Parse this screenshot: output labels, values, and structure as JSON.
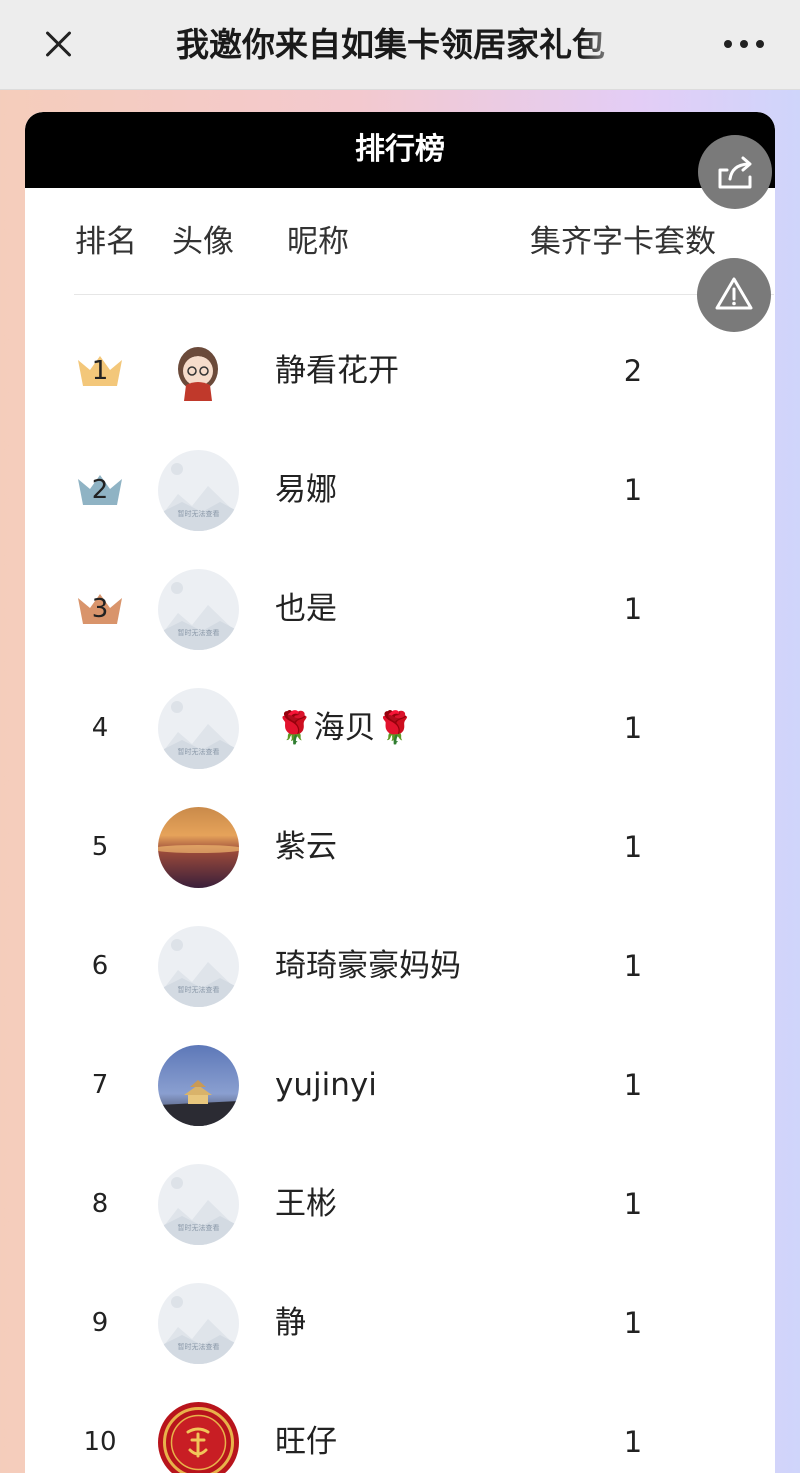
{
  "topbar": {
    "title": "我邀你来自如集卡领居家礼包"
  },
  "leaderboard": {
    "title": "排行榜",
    "headers": {
      "rank": "排名",
      "avatar": "头像",
      "nickname": "昵称",
      "sets": "集齐字卡套数"
    },
    "rows": [
      {
        "rank": "1",
        "nickname": "静看花开",
        "sets": "2",
        "avatar": "girl-avatar-icon",
        "crown": "gold"
      },
      {
        "rank": "2",
        "nickname": "易娜",
        "sets": "1",
        "avatar": "placeholder",
        "crown": "silver"
      },
      {
        "rank": "3",
        "nickname": "也是",
        "sets": "1",
        "avatar": "placeholder",
        "crown": "bronze"
      },
      {
        "rank": "4",
        "nickname": "🌹海贝🌹",
        "sets": "1",
        "avatar": "placeholder",
        "crown": ""
      },
      {
        "rank": "5",
        "nickname": "紫云",
        "sets": "1",
        "avatar": "sunset-photo",
        "crown": ""
      },
      {
        "rank": "6",
        "nickname": "琦琦豪豪妈妈",
        "sets": "1",
        "avatar": "placeholder",
        "crown": ""
      },
      {
        "rank": "7",
        "nickname": "yujinyi",
        "sets": "1",
        "avatar": "temple-photo",
        "crown": ""
      },
      {
        "rank": "8",
        "nickname": "王彬",
        "sets": "1",
        "avatar": "placeholder",
        "crown": ""
      },
      {
        "rank": "9",
        "nickname": "静",
        "sets": "1",
        "avatar": "placeholder",
        "crown": ""
      },
      {
        "rank": "10",
        "nickname": "旺仔",
        "sets": "1",
        "avatar": "red-seal",
        "crown": ""
      }
    ]
  },
  "placeholder_avatar_text": "暂时无法查看",
  "colors": {
    "crown_gold": "#f3c77a",
    "crown_silver": "#8fb3c4",
    "crown_bronze": "#d9946b",
    "header_bg": "#000000",
    "float_button": "#7a7a7a"
  }
}
